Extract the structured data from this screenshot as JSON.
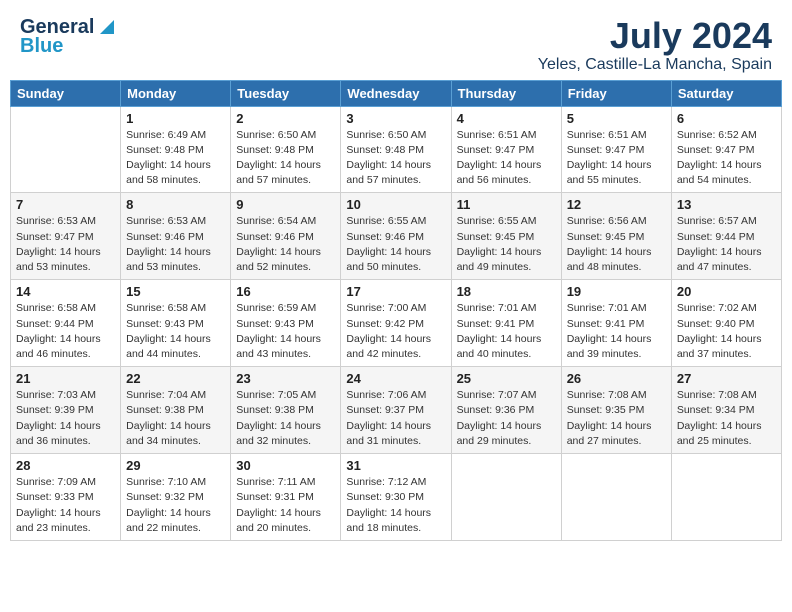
{
  "header": {
    "logo_general": "General",
    "logo_blue": "Blue",
    "month_year": "July 2024",
    "location": "Yeles, Castille-La Mancha, Spain"
  },
  "days_of_week": [
    "Sunday",
    "Monday",
    "Tuesday",
    "Wednesday",
    "Thursday",
    "Friday",
    "Saturday"
  ],
  "weeks": [
    [
      {
        "day": "",
        "sunrise": "",
        "sunset": "",
        "daylight": ""
      },
      {
        "day": "1",
        "sunrise": "Sunrise: 6:49 AM",
        "sunset": "Sunset: 9:48 PM",
        "daylight": "Daylight: 14 hours and 58 minutes."
      },
      {
        "day": "2",
        "sunrise": "Sunrise: 6:50 AM",
        "sunset": "Sunset: 9:48 PM",
        "daylight": "Daylight: 14 hours and 57 minutes."
      },
      {
        "day": "3",
        "sunrise": "Sunrise: 6:50 AM",
        "sunset": "Sunset: 9:48 PM",
        "daylight": "Daylight: 14 hours and 57 minutes."
      },
      {
        "day": "4",
        "sunrise": "Sunrise: 6:51 AM",
        "sunset": "Sunset: 9:47 PM",
        "daylight": "Daylight: 14 hours and 56 minutes."
      },
      {
        "day": "5",
        "sunrise": "Sunrise: 6:51 AM",
        "sunset": "Sunset: 9:47 PM",
        "daylight": "Daylight: 14 hours and 55 minutes."
      },
      {
        "day": "6",
        "sunrise": "Sunrise: 6:52 AM",
        "sunset": "Sunset: 9:47 PM",
        "daylight": "Daylight: 14 hours and 54 minutes."
      }
    ],
    [
      {
        "day": "7",
        "sunrise": "Sunrise: 6:53 AM",
        "sunset": "Sunset: 9:47 PM",
        "daylight": "Daylight: 14 hours and 53 minutes."
      },
      {
        "day": "8",
        "sunrise": "Sunrise: 6:53 AM",
        "sunset": "Sunset: 9:46 PM",
        "daylight": "Daylight: 14 hours and 53 minutes."
      },
      {
        "day": "9",
        "sunrise": "Sunrise: 6:54 AM",
        "sunset": "Sunset: 9:46 PM",
        "daylight": "Daylight: 14 hours and 52 minutes."
      },
      {
        "day": "10",
        "sunrise": "Sunrise: 6:55 AM",
        "sunset": "Sunset: 9:46 PM",
        "daylight": "Daylight: 14 hours and 50 minutes."
      },
      {
        "day": "11",
        "sunrise": "Sunrise: 6:55 AM",
        "sunset": "Sunset: 9:45 PM",
        "daylight": "Daylight: 14 hours and 49 minutes."
      },
      {
        "day": "12",
        "sunrise": "Sunrise: 6:56 AM",
        "sunset": "Sunset: 9:45 PM",
        "daylight": "Daylight: 14 hours and 48 minutes."
      },
      {
        "day": "13",
        "sunrise": "Sunrise: 6:57 AM",
        "sunset": "Sunset: 9:44 PM",
        "daylight": "Daylight: 14 hours and 47 minutes."
      }
    ],
    [
      {
        "day": "14",
        "sunrise": "Sunrise: 6:58 AM",
        "sunset": "Sunset: 9:44 PM",
        "daylight": "Daylight: 14 hours and 46 minutes."
      },
      {
        "day": "15",
        "sunrise": "Sunrise: 6:58 AM",
        "sunset": "Sunset: 9:43 PM",
        "daylight": "Daylight: 14 hours and 44 minutes."
      },
      {
        "day": "16",
        "sunrise": "Sunrise: 6:59 AM",
        "sunset": "Sunset: 9:43 PM",
        "daylight": "Daylight: 14 hours and 43 minutes."
      },
      {
        "day": "17",
        "sunrise": "Sunrise: 7:00 AM",
        "sunset": "Sunset: 9:42 PM",
        "daylight": "Daylight: 14 hours and 42 minutes."
      },
      {
        "day": "18",
        "sunrise": "Sunrise: 7:01 AM",
        "sunset": "Sunset: 9:41 PM",
        "daylight": "Daylight: 14 hours and 40 minutes."
      },
      {
        "day": "19",
        "sunrise": "Sunrise: 7:01 AM",
        "sunset": "Sunset: 9:41 PM",
        "daylight": "Daylight: 14 hours and 39 minutes."
      },
      {
        "day": "20",
        "sunrise": "Sunrise: 7:02 AM",
        "sunset": "Sunset: 9:40 PM",
        "daylight": "Daylight: 14 hours and 37 minutes."
      }
    ],
    [
      {
        "day": "21",
        "sunrise": "Sunrise: 7:03 AM",
        "sunset": "Sunset: 9:39 PM",
        "daylight": "Daylight: 14 hours and 36 minutes."
      },
      {
        "day": "22",
        "sunrise": "Sunrise: 7:04 AM",
        "sunset": "Sunset: 9:38 PM",
        "daylight": "Daylight: 14 hours and 34 minutes."
      },
      {
        "day": "23",
        "sunrise": "Sunrise: 7:05 AM",
        "sunset": "Sunset: 9:38 PM",
        "daylight": "Daylight: 14 hours and 32 minutes."
      },
      {
        "day": "24",
        "sunrise": "Sunrise: 7:06 AM",
        "sunset": "Sunset: 9:37 PM",
        "daylight": "Daylight: 14 hours and 31 minutes."
      },
      {
        "day": "25",
        "sunrise": "Sunrise: 7:07 AM",
        "sunset": "Sunset: 9:36 PM",
        "daylight": "Daylight: 14 hours and 29 minutes."
      },
      {
        "day": "26",
        "sunrise": "Sunrise: 7:08 AM",
        "sunset": "Sunset: 9:35 PM",
        "daylight": "Daylight: 14 hours and 27 minutes."
      },
      {
        "day": "27",
        "sunrise": "Sunrise: 7:08 AM",
        "sunset": "Sunset: 9:34 PM",
        "daylight": "Daylight: 14 hours and 25 minutes."
      }
    ],
    [
      {
        "day": "28",
        "sunrise": "Sunrise: 7:09 AM",
        "sunset": "Sunset: 9:33 PM",
        "daylight": "Daylight: 14 hours and 23 minutes."
      },
      {
        "day": "29",
        "sunrise": "Sunrise: 7:10 AM",
        "sunset": "Sunset: 9:32 PM",
        "daylight": "Daylight: 14 hours and 22 minutes."
      },
      {
        "day": "30",
        "sunrise": "Sunrise: 7:11 AM",
        "sunset": "Sunset: 9:31 PM",
        "daylight": "Daylight: 14 hours and 20 minutes."
      },
      {
        "day": "31",
        "sunrise": "Sunrise: 7:12 AM",
        "sunset": "Sunset: 9:30 PM",
        "daylight": "Daylight: 14 hours and 18 minutes."
      },
      {
        "day": "",
        "sunrise": "",
        "sunset": "",
        "daylight": ""
      },
      {
        "day": "",
        "sunrise": "",
        "sunset": "",
        "daylight": ""
      },
      {
        "day": "",
        "sunrise": "",
        "sunset": "",
        "daylight": ""
      }
    ]
  ]
}
